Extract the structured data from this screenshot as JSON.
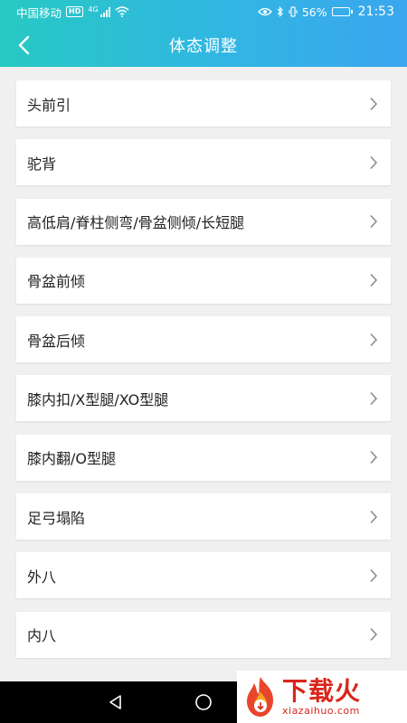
{
  "status_bar": {
    "carrier": "中国移动",
    "hd_badge": "HD",
    "network_type": "4G",
    "battery_percent": "56%",
    "battery_level": 0.56,
    "time": "21:53"
  },
  "title_bar": {
    "title": "体态调整"
  },
  "list": {
    "items": [
      {
        "label": "头前引"
      },
      {
        "label": "驼背"
      },
      {
        "label": "高低肩/脊柱侧弯/骨盆侧倾/长短腿"
      },
      {
        "label": "骨盆前倾"
      },
      {
        "label": "骨盆后倾"
      },
      {
        "label": "膝内扣/X型腿/XO型腿"
      },
      {
        "label": "膝内翻/O型腿"
      },
      {
        "label": "足弓塌陷"
      },
      {
        "label": "外八"
      },
      {
        "label": "内八"
      }
    ]
  },
  "watermark": {
    "title": "下载火",
    "url": "xiazaihuo.com"
  },
  "colors": {
    "header_start": "#27c9c3",
    "header_end": "#3aa6ee",
    "background": "#f0f0f0",
    "chevron": "#888888",
    "watermark_red": "#d9261c"
  }
}
